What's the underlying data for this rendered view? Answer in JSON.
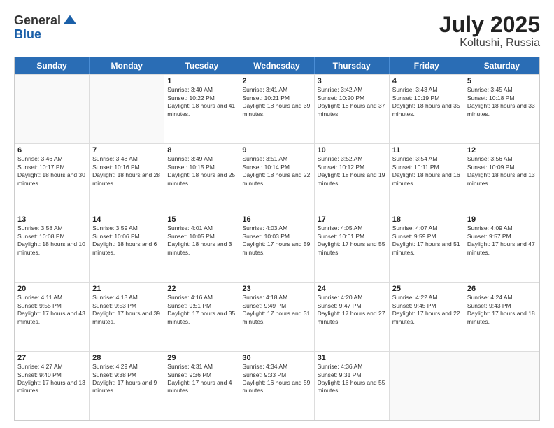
{
  "logo": {
    "general": "General",
    "blue": "Blue"
  },
  "title": {
    "month": "July 2025",
    "location": "Koltushi, Russia"
  },
  "header_days": [
    "Sunday",
    "Monday",
    "Tuesday",
    "Wednesday",
    "Thursday",
    "Friday",
    "Saturday"
  ],
  "weeks": [
    [
      {
        "day": "",
        "sunrise": "",
        "sunset": "",
        "daylight": "",
        "empty": true
      },
      {
        "day": "",
        "sunrise": "",
        "sunset": "",
        "daylight": "",
        "empty": true
      },
      {
        "day": "1",
        "sunrise": "Sunrise: 3:40 AM",
        "sunset": "Sunset: 10:22 PM",
        "daylight": "Daylight: 18 hours and 41 minutes."
      },
      {
        "day": "2",
        "sunrise": "Sunrise: 3:41 AM",
        "sunset": "Sunset: 10:21 PM",
        "daylight": "Daylight: 18 hours and 39 minutes."
      },
      {
        "day": "3",
        "sunrise": "Sunrise: 3:42 AM",
        "sunset": "Sunset: 10:20 PM",
        "daylight": "Daylight: 18 hours and 37 minutes."
      },
      {
        "day": "4",
        "sunrise": "Sunrise: 3:43 AM",
        "sunset": "Sunset: 10:19 PM",
        "daylight": "Daylight: 18 hours and 35 minutes."
      },
      {
        "day": "5",
        "sunrise": "Sunrise: 3:45 AM",
        "sunset": "Sunset: 10:18 PM",
        "daylight": "Daylight: 18 hours and 33 minutes."
      }
    ],
    [
      {
        "day": "6",
        "sunrise": "Sunrise: 3:46 AM",
        "sunset": "Sunset: 10:17 PM",
        "daylight": "Daylight: 18 hours and 30 minutes."
      },
      {
        "day": "7",
        "sunrise": "Sunrise: 3:48 AM",
        "sunset": "Sunset: 10:16 PM",
        "daylight": "Daylight: 18 hours and 28 minutes."
      },
      {
        "day": "8",
        "sunrise": "Sunrise: 3:49 AM",
        "sunset": "Sunset: 10:15 PM",
        "daylight": "Daylight: 18 hours and 25 minutes."
      },
      {
        "day": "9",
        "sunrise": "Sunrise: 3:51 AM",
        "sunset": "Sunset: 10:14 PM",
        "daylight": "Daylight: 18 hours and 22 minutes."
      },
      {
        "day": "10",
        "sunrise": "Sunrise: 3:52 AM",
        "sunset": "Sunset: 10:12 PM",
        "daylight": "Daylight: 18 hours and 19 minutes."
      },
      {
        "day": "11",
        "sunrise": "Sunrise: 3:54 AM",
        "sunset": "Sunset: 10:11 PM",
        "daylight": "Daylight: 18 hours and 16 minutes."
      },
      {
        "day": "12",
        "sunrise": "Sunrise: 3:56 AM",
        "sunset": "Sunset: 10:09 PM",
        "daylight": "Daylight: 18 hours and 13 minutes."
      }
    ],
    [
      {
        "day": "13",
        "sunrise": "Sunrise: 3:58 AM",
        "sunset": "Sunset: 10:08 PM",
        "daylight": "Daylight: 18 hours and 10 minutes."
      },
      {
        "day": "14",
        "sunrise": "Sunrise: 3:59 AM",
        "sunset": "Sunset: 10:06 PM",
        "daylight": "Daylight: 18 hours and 6 minutes."
      },
      {
        "day": "15",
        "sunrise": "Sunrise: 4:01 AM",
        "sunset": "Sunset: 10:05 PM",
        "daylight": "Daylight: 18 hours and 3 minutes."
      },
      {
        "day": "16",
        "sunrise": "Sunrise: 4:03 AM",
        "sunset": "Sunset: 10:03 PM",
        "daylight": "Daylight: 17 hours and 59 minutes."
      },
      {
        "day": "17",
        "sunrise": "Sunrise: 4:05 AM",
        "sunset": "Sunset: 10:01 PM",
        "daylight": "Daylight: 17 hours and 55 minutes."
      },
      {
        "day": "18",
        "sunrise": "Sunrise: 4:07 AM",
        "sunset": "Sunset: 9:59 PM",
        "daylight": "Daylight: 17 hours and 51 minutes."
      },
      {
        "day": "19",
        "sunrise": "Sunrise: 4:09 AM",
        "sunset": "Sunset: 9:57 PM",
        "daylight": "Daylight: 17 hours and 47 minutes."
      }
    ],
    [
      {
        "day": "20",
        "sunrise": "Sunrise: 4:11 AM",
        "sunset": "Sunset: 9:55 PM",
        "daylight": "Daylight: 17 hours and 43 minutes."
      },
      {
        "day": "21",
        "sunrise": "Sunrise: 4:13 AM",
        "sunset": "Sunset: 9:53 PM",
        "daylight": "Daylight: 17 hours and 39 minutes."
      },
      {
        "day": "22",
        "sunrise": "Sunrise: 4:16 AM",
        "sunset": "Sunset: 9:51 PM",
        "daylight": "Daylight: 17 hours and 35 minutes."
      },
      {
        "day": "23",
        "sunrise": "Sunrise: 4:18 AM",
        "sunset": "Sunset: 9:49 PM",
        "daylight": "Daylight: 17 hours and 31 minutes."
      },
      {
        "day": "24",
        "sunrise": "Sunrise: 4:20 AM",
        "sunset": "Sunset: 9:47 PM",
        "daylight": "Daylight: 17 hours and 27 minutes."
      },
      {
        "day": "25",
        "sunrise": "Sunrise: 4:22 AM",
        "sunset": "Sunset: 9:45 PM",
        "daylight": "Daylight: 17 hours and 22 minutes."
      },
      {
        "day": "26",
        "sunrise": "Sunrise: 4:24 AM",
        "sunset": "Sunset: 9:43 PM",
        "daylight": "Daylight: 17 hours and 18 minutes."
      }
    ],
    [
      {
        "day": "27",
        "sunrise": "Sunrise: 4:27 AM",
        "sunset": "Sunset: 9:40 PM",
        "daylight": "Daylight: 17 hours and 13 minutes."
      },
      {
        "day": "28",
        "sunrise": "Sunrise: 4:29 AM",
        "sunset": "Sunset: 9:38 PM",
        "daylight": "Daylight: 17 hours and 9 minutes."
      },
      {
        "day": "29",
        "sunrise": "Sunrise: 4:31 AM",
        "sunset": "Sunset: 9:36 PM",
        "daylight": "Daylight: 17 hours and 4 minutes."
      },
      {
        "day": "30",
        "sunrise": "Sunrise: 4:34 AM",
        "sunset": "Sunset: 9:33 PM",
        "daylight": "Daylight: 16 hours and 59 minutes."
      },
      {
        "day": "31",
        "sunrise": "Sunrise: 4:36 AM",
        "sunset": "Sunset: 9:31 PM",
        "daylight": "Daylight: 16 hours and 55 minutes."
      },
      {
        "day": "",
        "sunrise": "",
        "sunset": "",
        "daylight": "",
        "empty": true
      },
      {
        "day": "",
        "sunrise": "",
        "sunset": "",
        "daylight": "",
        "empty": true
      }
    ]
  ]
}
